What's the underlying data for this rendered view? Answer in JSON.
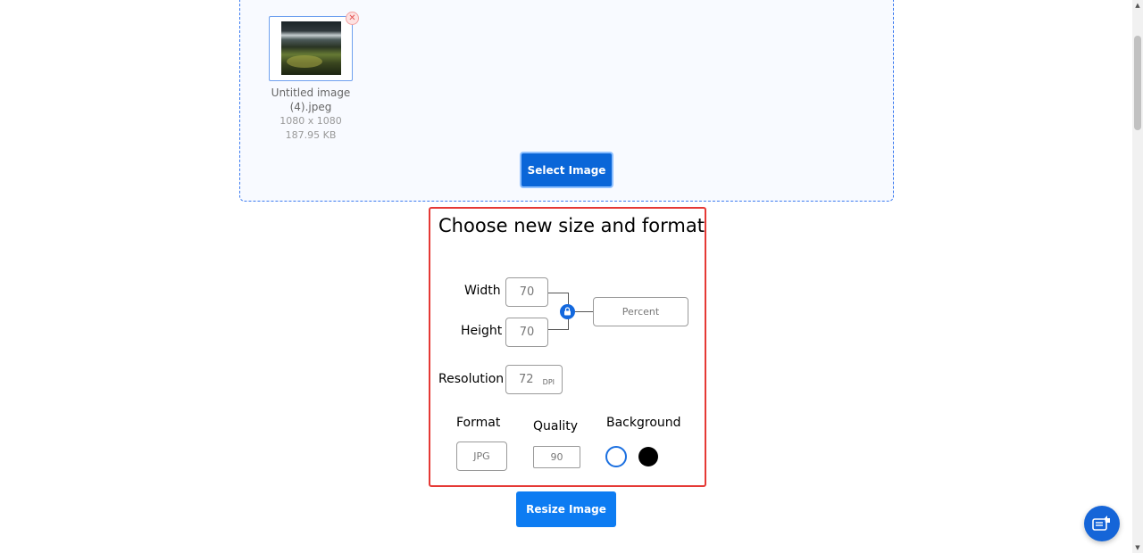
{
  "upload": {
    "file_name": "Untitled image (4).jpeg",
    "dimensions": "1080 x 1080",
    "file_size": "187.95 KB",
    "select_button": "Select Image",
    "remove_icon": "close-icon"
  },
  "options": {
    "title": "Choose new size and format",
    "width_label": "Width",
    "width_value": "70",
    "height_label": "Height",
    "height_value": "70",
    "unit_value": "Percent",
    "resolution_label": "Resolution",
    "resolution_value": "72",
    "resolution_unit": "DPI",
    "format_label": "Format",
    "format_value": "JPG",
    "quality_label": "Quality",
    "quality_value": "90",
    "background_label": "Background",
    "background_colors": [
      "#ffffff",
      "#000000"
    ],
    "aspect_lock_icon": "lock-icon"
  },
  "actions": {
    "resize_button": "Resize Image"
  },
  "colors": {
    "primary": "#0a66d8",
    "panel_border": "#e53935",
    "dropzone_border": "#3c7bf0"
  }
}
